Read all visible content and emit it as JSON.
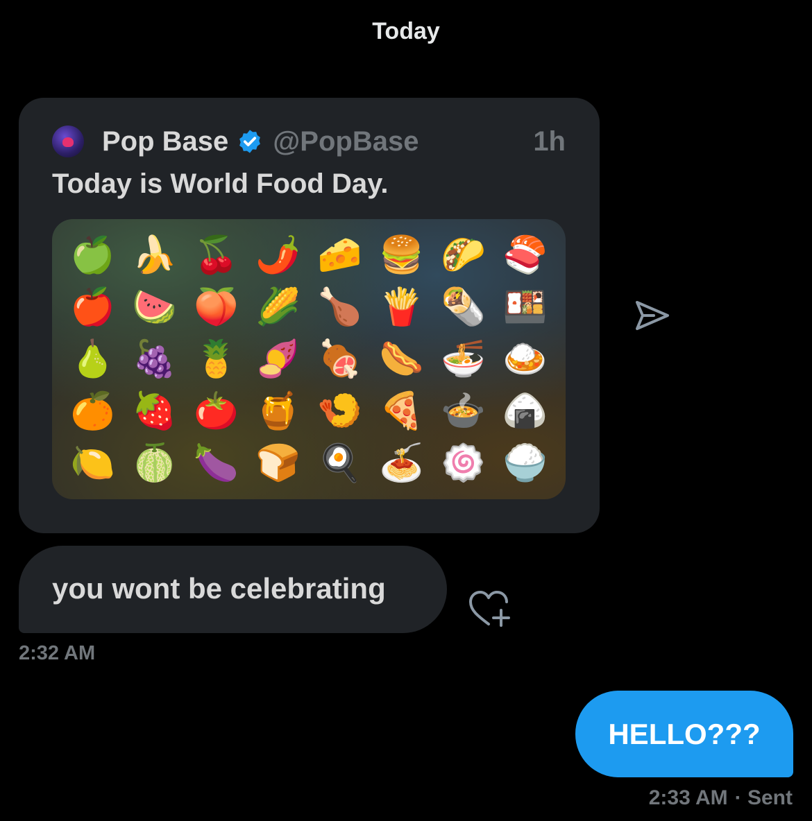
{
  "conversation": {
    "day_separator": "Today"
  },
  "quoted_tweet": {
    "author_name": "Pop Base",
    "handle": "@PopBase",
    "age": "1h",
    "text": "Today is World Food Day.",
    "verified": true,
    "media_emojis": [
      [
        "🍏",
        "🍌",
        "🍒",
        "🌶️",
        "🧀",
        "🍔",
        "🌮",
        "🍣"
      ],
      [
        "🍎",
        "🍉",
        "🍑",
        "🌽",
        "🍗",
        "🍟",
        "🌯",
        "🍱"
      ],
      [
        "🍐",
        "🍇",
        "🍍",
        "🍠",
        "🍖",
        "🌭",
        "🍜",
        "🍛"
      ],
      [
        "🍊",
        "🍓",
        "🍅",
        "🍯",
        "🍤",
        "🍕",
        "🍲",
        "🍙"
      ],
      [
        "🍋",
        "🍈",
        "🍆",
        "🍞",
        "🍳",
        "🍝",
        "🍥",
        "🍚"
      ]
    ]
  },
  "messages": [
    {
      "direction": "received",
      "text": "you wont be celebrating",
      "time": "2:32 AM"
    },
    {
      "direction": "sent",
      "text": "HELLO???",
      "time": "2:33 AM",
      "status": "· Sent"
    }
  ],
  "colors": {
    "background": "#000000",
    "bubble_received": "#202327",
    "bubble_sent": "#1d9bf0",
    "muted_text": "#71767b",
    "verified_badge": "#1d9bf0"
  },
  "icons": {
    "share": "share-icon",
    "reaction": "add-reaction-icon",
    "verified": "verified-badge-icon"
  }
}
